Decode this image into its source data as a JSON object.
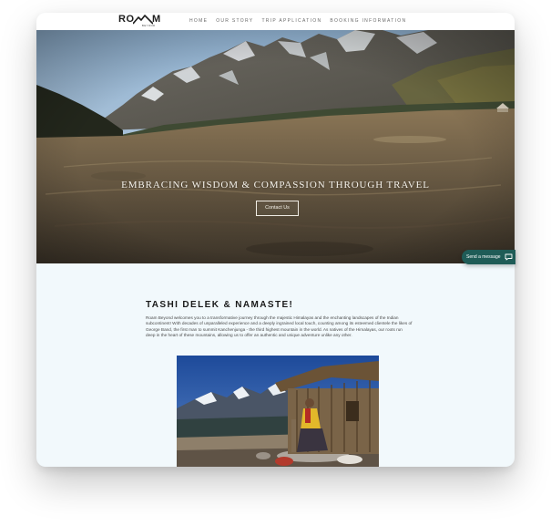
{
  "brand": {
    "logo_left": "RO",
    "logo_right": "M",
    "logo_sub": "BEYOND",
    "accent_color": "#1f5c57"
  },
  "nav": {
    "items": [
      {
        "label": "HOME"
      },
      {
        "label": "OUR STORY"
      },
      {
        "label": "TRIP APPLICATION"
      },
      {
        "label": "BOOKING INFORMATION"
      }
    ]
  },
  "hero": {
    "title": "EMBRACING WISDOM & COMPASSION THROUGH TRAVEL",
    "button_label": "Contact Us"
  },
  "chat": {
    "label": "Send a message",
    "icon": "chat-bubble-icon"
  },
  "intro": {
    "heading": "TASHI DELEK & NAMASTE!",
    "body": "Roam Beyond welcomes you to a transformative journey through the majestic Himalayas and the enchanting landscapes of the Indian subcontinent! With decades of unparalleled experience and a deeply ingrained local touch, counting among its esteemed clientele the likes of George Band, the first man to summit Kanchenjunga - the third highest mountain in the world. As natives of the Himalayas, our roots run deep in the heart of these mountains, allowing us to offer an authentic and unique adventure unlike any other."
  }
}
